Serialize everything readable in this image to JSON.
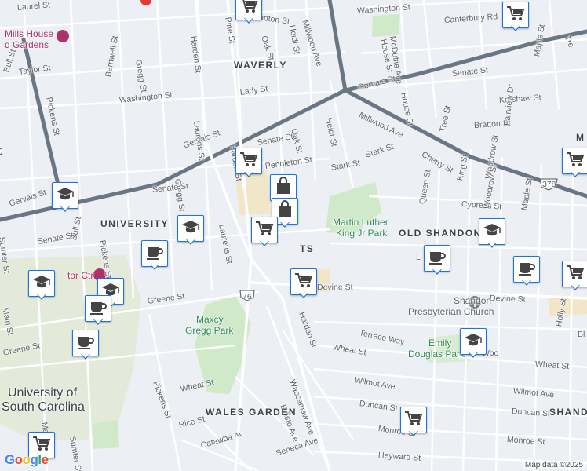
{
  "attribution": "Map data ©2025",
  "logo": "Google",
  "neighborhoods": [
    "WAVERLY",
    "UNIVERSITY",
    "OLD SHANDON",
    "WALES GARDEN",
    "SHAND"
  ],
  "places": {
    "mills_house": "Mills House",
    "mills_house_2": "d Gardens",
    "mlk_park_1": "Martin Luther",
    "mlk_park_2": "King Jr Park",
    "maxcy_1": "Maxcy",
    "maxcy_2": "Gregg Park",
    "emily_1": "Emily",
    "emily_2": "Douglas Park",
    "church_1": "Shandon",
    "church_2": "Presbyterian Church",
    "usc_1": "University of",
    "usc_2": "South Carolina",
    "ctr": "tor Ctr",
    "corner_m": "M",
    "corner_b": "Bl",
    "five_points_fragment": "TS"
  },
  "streets": {
    "laurel": "Laurel St",
    "hampton": "Hampton St",
    "pine_top": "Pine St",
    "oak_top": "Oak St",
    "heidt_top": "Heidt St",
    "millwood_top": "Millwood Ave",
    "washington_top": "Washington St",
    "mcduffie": "McDuffie Ave",
    "house_top": "House St",
    "canterbury": "Canterbury Rd",
    "tre": "Tre",
    "bull_top": "Bull St",
    "taylor": "Taylor St",
    "barnwell": "Barnwell St",
    "gregg_top": "Gregg St",
    "harden_top": "Harden St",
    "washington_mid": "Washington St",
    "pickens_top": "Pickens St",
    "lady": "Lady St",
    "gervais_e": "Gervais St",
    "senate_e": "Senate St",
    "maple_top": "Maple St",
    "house_mid": "House St",
    "kershaw": "Kershaw St",
    "millwood_mid": "Millwood Ave",
    "marion": "Marion St",
    "laurens_top": "Laurens St",
    "gervais_mid": "Gervais St",
    "harden_mid": "Harden St",
    "senate_mid": "Senate St",
    "oak_mid": "Oak St",
    "heidt_mid": "Heidt St",
    "tree": "Tree St",
    "bratton": "Bratton St",
    "cherry": "Cherry St",
    "pendleton": "Pendleton St",
    "stark1": "Stark St",
    "stark2": "Stark St",
    "gregg_mid": "Gregg St",
    "king": "King St",
    "woodrow_top": "Woodrow St",
    "fairview": "Fairview Dr",
    "route378": "378",
    "gervais_w": "Gervais St",
    "senate_w": "Senate St",
    "queen": "Queen St",
    "cypress": "Cypress St",
    "woodrow_mid": "Woodrow St",
    "maple_mid": "Maple St",
    "sumter_top": "Sumter St",
    "senate_sw": "Senate St",
    "bull_mid": "Bull St",
    "pickens_mid": "Pickens St",
    "laurens_mid": "Laurens St",
    "l_frag": "L",
    "main": "Main St",
    "route76": "76",
    "devine_w": "Devine St",
    "devine_e": "Devine St",
    "greene_mid": "Greene St",
    "harden_s": "Harden St",
    "terrace": "Terrace Way",
    "wheat_mid": "Wheat St",
    "wheat_e": "Wheat St",
    "holly": "Holly St",
    "greene_w": "Greene St",
    "waccamaw": "Waccamaw Ave",
    "woo": "Woo",
    "wilmot1": "Wilmot Ave",
    "wilmot2": "Wilmot Ave",
    "pickens_s": "Pickens St",
    "wheat_sw": "Wheat St",
    "edisto": "Edisto Ave",
    "duncan1": "Duncan St",
    "duncan2": "Duncan St",
    "ma": "Ma",
    "sumter_s": "Sumter St",
    "rice": "Rice St",
    "monroe1": "Monroe St",
    "monroe2": "Monroe St",
    "catawba": "Catawba Av",
    "seneca": "Seneca Ave",
    "heyward": "Heyward St"
  },
  "colors": {
    "background": "#eceff3",
    "road": "#ffffff",
    "arterial": "#6b7684",
    "park": "#cfe9c9",
    "campus": "#dfe8d6",
    "pin_border": "#1a73e8"
  },
  "markers": [
    {
      "type": "grocery",
      "icon": "shopping-cart-icon"
    },
    {
      "type": "grocery",
      "icon": "shopping-cart-icon"
    },
    {
      "type": "education",
      "icon": "graduation-cap-icon"
    },
    {
      "type": "education",
      "icon": "graduation-cap-icon"
    },
    {
      "type": "education",
      "icon": "graduation-cap-icon"
    },
    {
      "type": "cafe",
      "icon": "coffee-cup-icon"
    },
    {
      "type": "education",
      "icon": "graduation-cap-icon"
    },
    {
      "type": "cafe",
      "icon": "coffee-cup-icon"
    },
    {
      "type": "cafe",
      "icon": "coffee-cup-icon"
    },
    {
      "type": "shopping",
      "icon": "shopping-bag-icon"
    },
    {
      "type": "shopping",
      "icon": "shopping-bag-icon"
    },
    {
      "type": "grocery",
      "icon": "shopping-cart-icon"
    },
    {
      "type": "grocery",
      "icon": "shopping-cart-icon"
    },
    {
      "type": "education",
      "icon": "graduation-cap-icon"
    },
    {
      "type": "cafe",
      "icon": "coffee-cup-icon"
    },
    {
      "type": "cafe",
      "icon": "coffee-cup-icon"
    },
    {
      "type": "grocery",
      "icon": "shopping-cart-icon"
    },
    {
      "type": "education",
      "icon": "graduation-cap-icon"
    },
    {
      "type": "grocery",
      "icon": "shopping-cart-icon"
    },
    {
      "type": "grocery",
      "icon": "shopping-cart-icon"
    },
    {
      "type": "grocery",
      "icon": "shopping-cart-icon"
    },
    {
      "type": "grocery",
      "icon": "shopping-cart-icon"
    }
  ]
}
